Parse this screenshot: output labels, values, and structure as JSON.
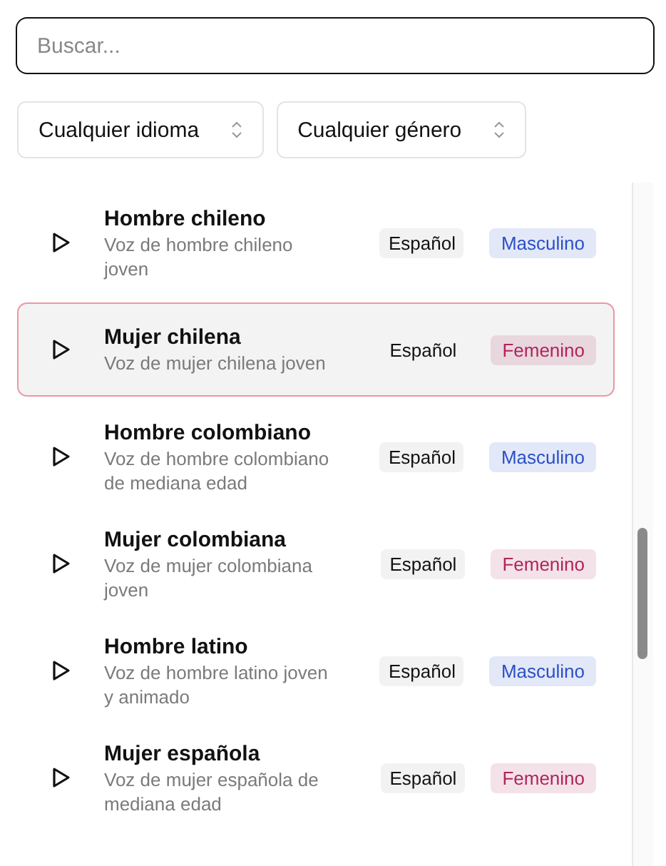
{
  "search": {
    "placeholder": "Buscar..."
  },
  "filters": [
    {
      "label": "Cualquier idioma"
    },
    {
      "label": "Cualquier género"
    }
  ],
  "voices": [
    {
      "name": "Hombre chileno",
      "description": "Voz de hombre chileno joven",
      "language": "Español",
      "gender": {
        "label": "Masculino",
        "color": "#2b4fc7"
      },
      "selected": false
    },
    {
      "name": "Mujer chilena",
      "description": "Voz de mujer chilena joven",
      "language": "Español",
      "gender": {
        "label": "Femenino",
        "color": "#b0245a"
      },
      "selected": true
    },
    {
      "name": "Hombre colombiano",
      "description": "Voz de hombre colombiano de mediana edad",
      "language": "Español",
      "gender": {
        "label": "Masculino",
        "color": "#2b4fc7"
      },
      "selected": false
    },
    {
      "name": "Mujer colombiana",
      "description": "Voz de mujer colombiana joven",
      "language": "Español",
      "gender": {
        "label": "Femenino",
        "color": "#b0245a"
      },
      "selected": false
    },
    {
      "name": "Hombre latino",
      "description": "Voz de hombre latino joven y animado",
      "language": "Español",
      "gender": {
        "label": "Masculino",
        "color": "#2b4fc7"
      },
      "selected": false
    },
    {
      "name": "Mujer española",
      "description": "Voz de mujer española de mediana edad",
      "language": "Español",
      "gender": {
        "label": "Femenino",
        "color": "#b0245a"
      },
      "selected": false
    }
  ]
}
